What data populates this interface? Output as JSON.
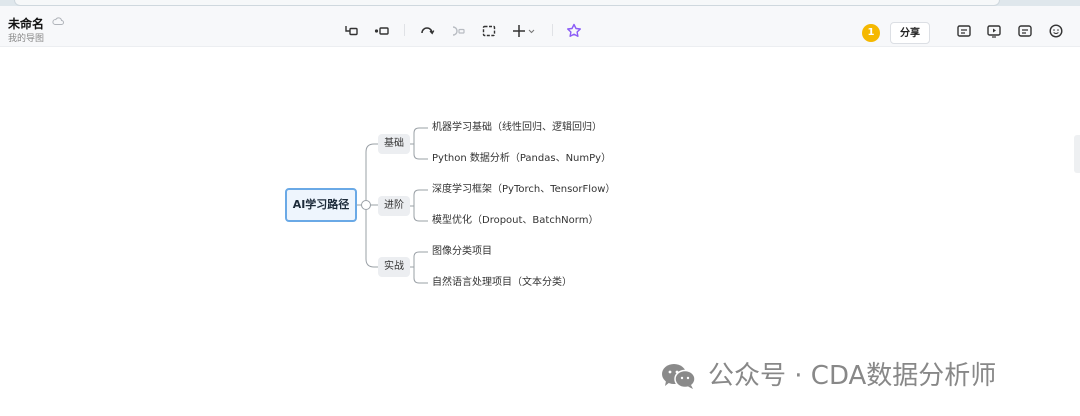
{
  "document": {
    "title": "未命名",
    "subtitle": "我的导图"
  },
  "toolbar": {
    "icons": [
      "child-node-icon",
      "sibling-node-icon",
      "undo-icon",
      "redo-icon",
      "frame-icon",
      "insert-icon",
      "theme-icon"
    ],
    "badge_count": "1",
    "share_label": "分享",
    "right_icons": [
      "outline-icon",
      "present-icon",
      "comment-icon",
      "emoji-icon"
    ]
  },
  "mindmap": {
    "root": "AI学习路径",
    "branches": [
      {
        "label": "基础",
        "leaves": [
          "机器学习基础（线性回归、逻辑回归）",
          "Python 数据分析（Pandas、NumPy）"
        ]
      },
      {
        "label": "进阶",
        "leaves": [
          "深度学习框架（PyTorch、TensorFlow）",
          "模型优化（Dropout、BatchNorm）"
        ]
      },
      {
        "label": "实战",
        "leaves": [
          "图像分类项目",
          "自然语言处理项目（文本分类）"
        ]
      }
    ]
  },
  "watermark": {
    "text": "公众号 · CDA数据分析师",
    "icon": "wechat-icon"
  },
  "colors": {
    "root_border": "#6aa9e6",
    "root_fill": "#eef5fd",
    "branch_fill": "#eceef1",
    "connector": "#9aa0a6",
    "badge": "#f5b800",
    "theme_icon": "#8b5cf6"
  }
}
